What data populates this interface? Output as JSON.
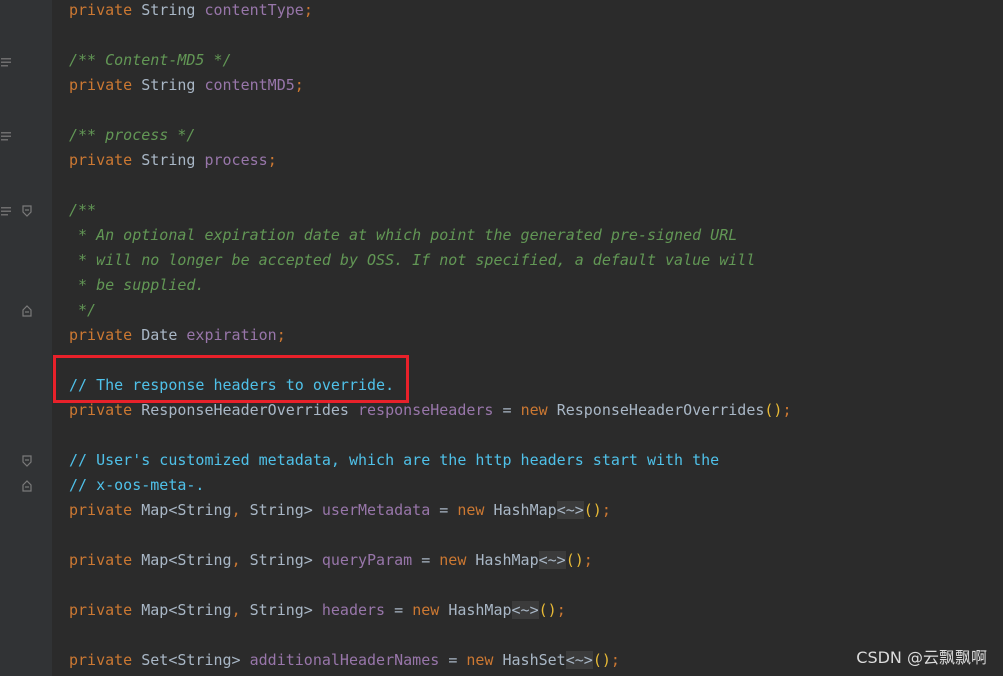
{
  "editor": {
    "lines": [
      {
        "kind": "decl",
        "modifier": "private",
        "type": "String",
        "name": "contentType",
        "end": ";"
      },
      {
        "kind": "doc",
        "text": "/** Content-MD5 */"
      },
      {
        "kind": "decl",
        "modifier": "private",
        "type": "String",
        "name": "contentMD5",
        "end": ";"
      },
      {
        "kind": "doc",
        "text": "/** process */"
      },
      {
        "kind": "decl",
        "modifier": "private",
        "type": "String",
        "name": "process",
        "end": ";"
      },
      {
        "kind": "doc",
        "text": "/**"
      },
      {
        "kind": "doc",
        "text": " * An optional expiration date at which point the generated pre-signed URL"
      },
      {
        "kind": "doc",
        "text": " * will no longer be accepted by OSS. If not specified, a default value will"
      },
      {
        "kind": "doc",
        "text": " * be supplied."
      },
      {
        "kind": "doc",
        "text": " */"
      },
      {
        "kind": "decl",
        "modifier": "private",
        "type": "Date",
        "name": "expiration",
        "end": ";"
      },
      {
        "kind": "comment",
        "text": "// The response headers to override."
      },
      {
        "kind": "init",
        "modifier": "private",
        "type": "ResponseHeaderOverrides",
        "name": "responseHeaders",
        "eq": "=",
        "new": "new",
        "ctor": "ResponseHeaderOverrides",
        "generic": "",
        "parens": "()",
        "end": ";"
      },
      {
        "kind": "comment",
        "text": "// User's customized metadata, which are the http headers start with the"
      },
      {
        "kind": "comment",
        "text": "// x-oos-meta-."
      },
      {
        "kind": "init",
        "modifier": "private",
        "type_pre": "Map<String",
        "comma": ",",
        "type_post": " String>",
        "name": "userMetadata",
        "eq": "=",
        "new": "new",
        "ctor": "HashMap",
        "generic": "<~>",
        "parens": "()",
        "end": ";"
      },
      {
        "kind": "init",
        "modifier": "private",
        "type_pre": "Map<String",
        "comma": ",",
        "type_post": " String>",
        "name": "queryParam",
        "eq": "=",
        "new": "new",
        "ctor": "HashMap",
        "generic": "<~>",
        "parens": "()",
        "end": ";"
      },
      {
        "kind": "init",
        "modifier": "private",
        "type_pre": "Map<String",
        "comma": ",",
        "type_post": " String>",
        "name": "headers",
        "eq": "=",
        "new": "new",
        "ctor": "HashMap",
        "generic": "<~>",
        "parens": "()",
        "end": ";"
      },
      {
        "kind": "init",
        "modifier": "private",
        "type": "Set<String>",
        "name": "additionalHeaderNames",
        "eq": "=",
        "new": "new",
        "ctor": "HashSet",
        "generic": "<~>",
        "parens": "()",
        "end": ";"
      }
    ]
  },
  "watermark": "CSDN @云飘飘啊",
  "colors": {
    "background": "#2b2b2b",
    "keyword": "#cc7832",
    "field": "#9876aa",
    "doc_comment": "#629755",
    "line_comment": "#4fc1e9",
    "highlight_border": "#e8212a"
  }
}
